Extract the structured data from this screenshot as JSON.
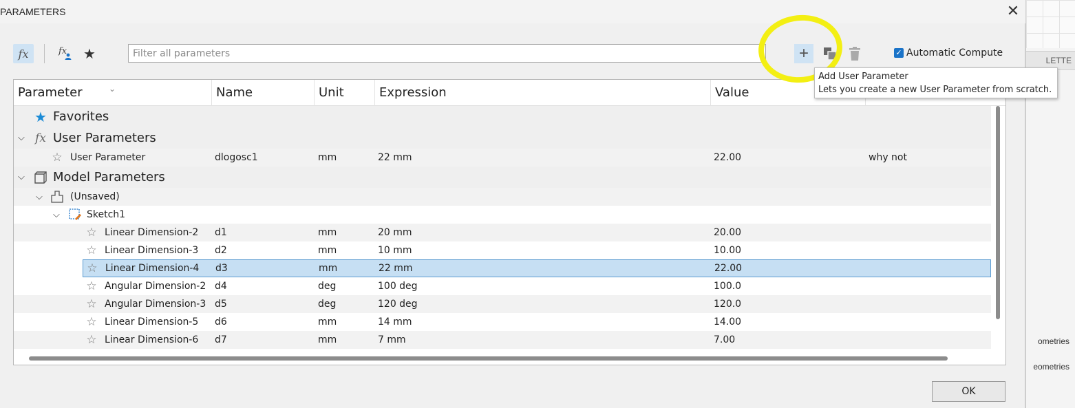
{
  "window": {
    "title": "PARAMETERS",
    "close_glyph": "✕"
  },
  "background": {
    "palette_tab": "LETTE",
    "text1": "ometries",
    "text2": "eometries"
  },
  "toolbar": {
    "filter_placeholder": "Filter all parameters",
    "fx_label": "fx",
    "fx_user_label": "fx",
    "add_glyph": "+",
    "automatic_compute_label": "Automatic Compute",
    "automatic_compute_checked": true
  },
  "table": {
    "columns": [
      "Parameter",
      "Name",
      "Unit",
      "Expression",
      "Value"
    ],
    "groups": {
      "favorites": "Favorites",
      "user_parameters": "User Parameters",
      "model_parameters": "Model Parameters",
      "unsaved": "(Unsaved)",
      "sketch": "Sketch1"
    },
    "user_rows": [
      {
        "parameter": "User Parameter",
        "name": "dlogosc1",
        "unit": "mm",
        "expression": "22 mm",
        "value": "22.00",
        "comment": "why not"
      }
    ],
    "model_rows": [
      {
        "parameter": "Linear Dimension-2",
        "name": "d1",
        "unit": "mm",
        "expression": "20 mm",
        "value": "20.00"
      },
      {
        "parameter": "Linear Dimension-3",
        "name": "d2",
        "unit": "mm",
        "expression": "10 mm",
        "value": "10.00"
      },
      {
        "parameter": "Linear Dimension-4",
        "name": "d3",
        "unit": "mm",
        "expression": "22 mm",
        "value": "22.00"
      },
      {
        "parameter": "Angular Dimension-2",
        "name": "d4",
        "unit": "deg",
        "expression": "100 deg",
        "value": "100.0"
      },
      {
        "parameter": "Angular Dimension-3",
        "name": "d5",
        "unit": "deg",
        "expression": "120 deg",
        "value": "120.0"
      },
      {
        "parameter": "Linear Dimension-5",
        "name": "d6",
        "unit": "mm",
        "expression": "14 mm",
        "value": "14.00"
      },
      {
        "parameter": "Linear Dimension-6",
        "name": "d7",
        "unit": "mm",
        "expression": "7 mm",
        "value": "7.00"
      }
    ],
    "selected_model_row": 2
  },
  "tooltip": {
    "title": "Add User Parameter",
    "description": "Lets you create a new User Parameter from scratch."
  },
  "footer": {
    "ok_label": "OK"
  },
  "colors": {
    "highlight": "#f3ef13",
    "selection": "#c6dff3",
    "accent": "#1a73c8",
    "star_filled": "#1a8bd6"
  }
}
